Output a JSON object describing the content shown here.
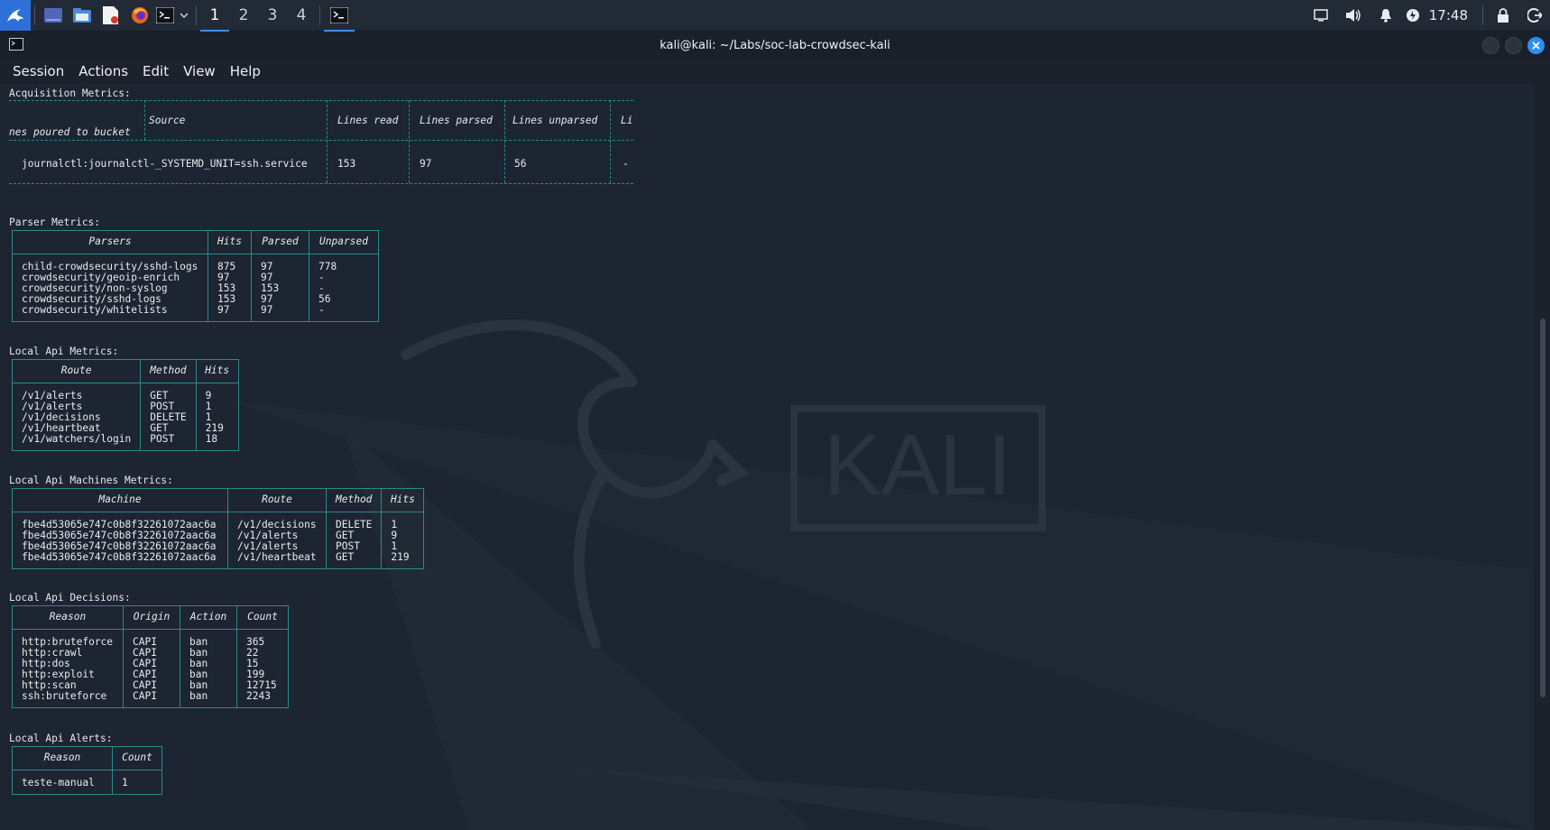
{
  "taskbar": {
    "workspaces": [
      "1",
      "2",
      "3",
      "4"
    ],
    "active_workspace": "1",
    "clock": "17:48",
    "icons": [
      "kali-menu-icon",
      "desktop-icon",
      "file-manager-icon",
      "text-editor-icon",
      "firefox-icon",
      "terminal-icon",
      "chevron-down-icon",
      "terminal-window-icon",
      "display-icon",
      "volume-icon",
      "bell-icon",
      "power-icon",
      "lock-icon",
      "logout-icon"
    ]
  },
  "window": {
    "title": "kali@kali: ~/Labs/soc-lab-crowdsec-kali",
    "menu": [
      "Session",
      "Actions",
      "Edit",
      "View",
      "Help"
    ]
  },
  "terminal": {
    "acquisition": {
      "heading": "Acquisition Metrics:",
      "headers": [
        "Source",
        "Lines read",
        "Lines parsed",
        "Lines unparsed",
        "Li"
      ],
      "header_wrap": "nes poured to bucket",
      "row": [
        "journalctl:journalctl-_SYSTEMD_UNIT=ssh.service",
        "153",
        "97",
        "56",
        "-"
      ]
    },
    "parser": {
      "heading": "Parser Metrics:",
      "headers": [
        "Parsers",
        "Hits",
        "Parsed",
        "Unparsed"
      ],
      "rows": [
        [
          "child-crowdsecurity/sshd-logs",
          "875",
          "97",
          "778"
        ],
        [
          "crowdsecurity/geoip-enrich",
          "97",
          "97",
          "-"
        ],
        [
          "crowdsecurity/non-syslog",
          "153",
          "153",
          "-"
        ],
        [
          "crowdsecurity/sshd-logs",
          "153",
          "97",
          "56"
        ],
        [
          "crowdsecurity/whitelists",
          "97",
          "97",
          "-"
        ]
      ]
    },
    "lapi": {
      "heading": "Local Api Metrics:",
      "headers": [
        "Route",
        "Method",
        "Hits"
      ],
      "rows": [
        [
          "/v1/alerts",
          "GET",
          "9"
        ],
        [
          "/v1/alerts",
          "POST",
          "1"
        ],
        [
          "/v1/decisions",
          "DELETE",
          "1"
        ],
        [
          "/v1/heartbeat",
          "GET",
          "219"
        ],
        [
          "/v1/watchers/login",
          "POST",
          "18"
        ]
      ]
    },
    "machines": {
      "heading": "Local Api Machines Metrics:",
      "headers": [
        "Machine",
        "Route",
        "Method",
        "Hits"
      ],
      "rows": [
        [
          "fbe4d53065e747c0b8f32261072aac6a",
          "/v1/decisions",
          "DELETE",
          "1"
        ],
        [
          "fbe4d53065e747c0b8f32261072aac6a",
          "/v1/alerts",
          "GET",
          "9"
        ],
        [
          "fbe4d53065e747c0b8f32261072aac6a",
          "/v1/alerts",
          "POST",
          "1"
        ],
        [
          "fbe4d53065e747c0b8f32261072aac6a",
          "/v1/heartbeat",
          "GET",
          "219"
        ]
      ]
    },
    "decisions": {
      "heading": "Local Api Decisions:",
      "headers": [
        "Reason",
        "Origin",
        "Action",
        "Count"
      ],
      "rows": [
        [
          "http:bruteforce",
          "CAPI",
          "ban",
          "365"
        ],
        [
          "http:crawl",
          "CAPI",
          "ban",
          "22"
        ],
        [
          "http:dos",
          "CAPI",
          "ban",
          "15"
        ],
        [
          "http:exploit",
          "CAPI",
          "ban",
          "199"
        ],
        [
          "http:scan",
          "CAPI",
          "ban",
          "12715"
        ],
        [
          "ssh:bruteforce",
          "CAPI",
          "ban",
          "2243"
        ]
      ]
    },
    "alerts": {
      "heading": "Local Api Alerts:",
      "headers": [
        "Reason",
        "Count"
      ],
      "rows": [
        [
          "teste-manual",
          "1"
        ]
      ]
    }
  },
  "wallpaper": {
    "logo_text": "KALI"
  },
  "colors": {
    "table_border": "#2a8a8c",
    "accent": "#2f8ef5"
  }
}
